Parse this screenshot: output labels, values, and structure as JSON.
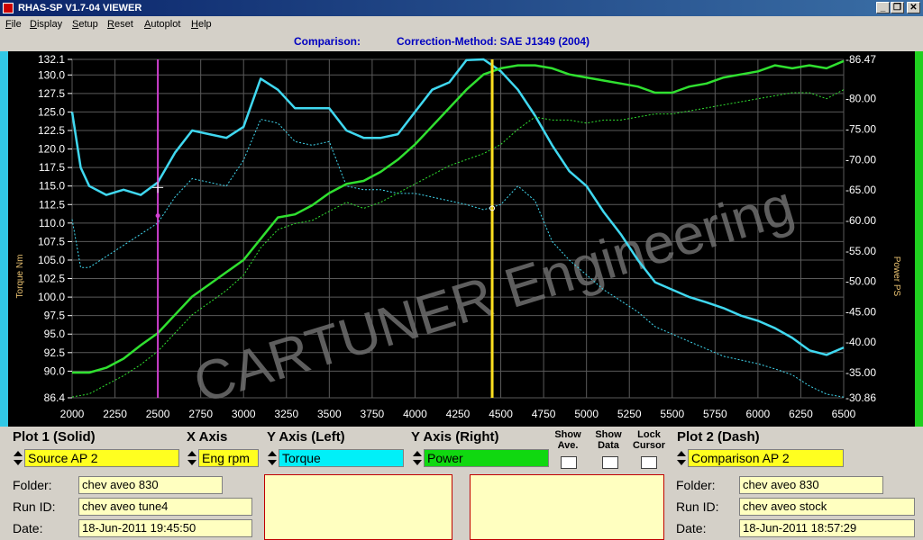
{
  "window": {
    "title": "RHAS-SP V1.7-04  VIEWER",
    "btn_min": "_",
    "btn_max": "❐",
    "btn_close": "✕"
  },
  "menu": [
    {
      "u": "F",
      "rest": "ile"
    },
    {
      "u": "D",
      "rest": "isplay"
    },
    {
      "u": "S",
      "rest": "etup"
    },
    {
      "u": "R",
      "rest": "eset"
    },
    {
      "u": "A",
      "rest": "utoplot"
    },
    {
      "u": "H",
      "rest": "elp"
    }
  ],
  "comparison": {
    "label": "Comparison:",
    "method": "Correction-Method: SAE J1349 (2004)"
  },
  "colors": {
    "torque": "#40d8f0",
    "power": "#30e030",
    "cursor": "#ffe020",
    "marker": "#d040d0",
    "grid": "#5a5a5a"
  },
  "chart_data": {
    "type": "line",
    "watermark": "CARTUNER Engineering",
    "xlabel": "",
    "ylabel_left": "Torque Nm",
    "ylabel_right": "Power PS",
    "x_ticks": [
      "2000",
      "2250",
      "2500",
      "2750",
      "3000",
      "3250",
      "3500",
      "3750",
      "4000",
      "4250",
      "4500",
      "4750",
      "5000",
      "5250",
      "5500",
      "5750",
      "6000",
      "6250",
      "6500"
    ],
    "xlim": [
      2000,
      6500
    ],
    "ylim_left": [
      86.4,
      132.1
    ],
    "ylim_right": [
      30.86,
      86.47
    ],
    "y_left_ticks": [
      "86.4",
      "90.0",
      "92.5",
      "95.0",
      "97.5",
      "100.0",
      "102.5",
      "105.0",
      "107.5",
      "110.0",
      "112.5",
      "115.0",
      "117.5",
      "120.0",
      "122.5",
      "125.0",
      "127.5",
      "130.0",
      "132.1"
    ],
    "y_right_ticks": [
      "30.86",
      "35.00",
      "40.00",
      "45.00",
      "50.00",
      "55.00",
      "60.00",
      "65.00",
      "70.00",
      "75.00",
      "80.00",
      "86.47"
    ],
    "grid": true,
    "marker_rpm": 2500,
    "cursor_rpm": 4450,
    "series": [
      {
        "axis": "left",
        "style": "solid",
        "color": "#40d8f0",
        "x": [
          2000,
          2050,
          2100,
          2200,
          2300,
          2400,
          2500,
          2600,
          2700,
          2800,
          2900,
          3000,
          3100,
          3200,
          3300,
          3400,
          3500,
          3600,
          3700,
          3800,
          3900,
          4000,
          4100,
          4200,
          4300,
          4400,
          4500,
          4600,
          4700,
          4800,
          4900,
          5000,
          5100,
          5200,
          5300,
          5400,
          5500,
          5600,
          5700,
          5800,
          5900,
          6000,
          6100,
          6200,
          6300,
          6400,
          6500
        ],
        "y": [
          125.0,
          117.5,
          115.0,
          113.8,
          114.5,
          113.8,
          115.5,
          119.5,
          122.5,
          122.0,
          121.5,
          123.0,
          129.5,
          128.0,
          125.5,
          125.5,
          125.5,
          122.5,
          121.5,
          121.5,
          122.0,
          125.0,
          128.0,
          129.0,
          132.0,
          132.1,
          130.5,
          128.0,
          124.5,
          120.5,
          117.0,
          115.0,
          111.5,
          108.5,
          105.0,
          102.0,
          101.0,
          100.0,
          99.3,
          98.5,
          97.5,
          96.8,
          95.8,
          94.5,
          92.8,
          92.2,
          93.2
        ]
      },
      {
        "axis": "left",
        "style": "dash",
        "color": "#40d8f0",
        "x": [
          2000,
          2050,
          2100,
          2200,
          2300,
          2400,
          2500,
          2600,
          2700,
          2800,
          2900,
          3000,
          3100,
          3200,
          3300,
          3400,
          3500,
          3600,
          3700,
          3800,
          3900,
          4000,
          4100,
          4200,
          4300,
          4400,
          4500,
          4600,
          4700,
          4800,
          4900,
          5000,
          5100,
          5200,
          5300,
          5400,
          5500,
          5600,
          5700,
          5800,
          5900,
          6000,
          6100,
          6200,
          6300,
          6400,
          6500
        ],
        "y": [
          110.5,
          104.0,
          104.0,
          105.5,
          107.0,
          108.5,
          110.0,
          113.5,
          116.0,
          115.5,
          115.0,
          118.5,
          124.0,
          123.5,
          121.0,
          120.5,
          121.0,
          115.0,
          114.5,
          114.5,
          114.0,
          114.0,
          113.5,
          113.0,
          112.5,
          111.8,
          112.5,
          115.0,
          113.0,
          107.5,
          105.0,
          103.0,
          101.0,
          99.5,
          98.0,
          96.0,
          95.0,
          94.0,
          93.0,
          92.0,
          91.5,
          91.0,
          90.3,
          89.5,
          88.0,
          86.9,
          86.5
        ]
      },
      {
        "axis": "right",
        "style": "solid",
        "color": "#30e030",
        "x": [
          2000,
          2100,
          2200,
          2300,
          2400,
          2500,
          2600,
          2700,
          2800,
          2900,
          3000,
          3100,
          3200,
          3300,
          3400,
          3500,
          3600,
          3700,
          3800,
          3900,
          4000,
          4100,
          4200,
          4300,
          4400,
          4500,
          4600,
          4700,
          4800,
          4900,
          5000,
          5100,
          5200,
          5300,
          5400,
          5500,
          5600,
          5700,
          5800,
          5900,
          6000,
          6100,
          6200,
          6300,
          6400,
          6500
        ],
        "y": [
          35.0,
          35.0,
          35.8,
          37.3,
          39.5,
          41.5,
          44.5,
          47.5,
          49.5,
          51.5,
          53.5,
          57.0,
          60.5,
          61.0,
          62.5,
          64.5,
          66.0,
          66.5,
          68.0,
          70.0,
          72.5,
          75.5,
          78.5,
          81.5,
          84.0,
          85.0,
          85.5,
          85.5,
          85.0,
          84.0,
          83.5,
          83.0,
          82.5,
          82.0,
          81.0,
          81.0,
          82.0,
          82.5,
          83.5,
          84.0,
          84.5,
          85.5,
          85.0,
          85.5,
          85.0,
          86.2
        ]
      },
      {
        "axis": "right",
        "style": "dash",
        "color": "#30e030",
        "x": [
          2000,
          2100,
          2200,
          2300,
          2400,
          2500,
          2600,
          2700,
          2800,
          2900,
          3000,
          3100,
          3200,
          3300,
          3400,
          3500,
          3600,
          3700,
          3800,
          3900,
          4000,
          4100,
          4200,
          4300,
          4400,
          4500,
          4600,
          4700,
          4800,
          4900,
          5000,
          5100,
          5200,
          5300,
          5400,
          5500,
          5600,
          5700,
          5800,
          5900,
          6000,
          6100,
          6200,
          6300,
          6400,
          6500
        ],
        "y": [
          31.0,
          31.5,
          33.0,
          34.5,
          36.3,
          38.5,
          41.5,
          44.5,
          46.5,
          48.5,
          51.0,
          55.5,
          58.5,
          59.5,
          60.0,
          61.5,
          63.0,
          62.0,
          63.0,
          64.5,
          66.0,
          67.5,
          69.0,
          70.0,
          71.0,
          72.5,
          75.0,
          77.0,
          76.5,
          76.5,
          76.0,
          76.5,
          76.5,
          77.0,
          77.5,
          77.5,
          78.0,
          78.5,
          79.0,
          79.5,
          80.0,
          80.5,
          81.0,
          81.0,
          80.0,
          81.5
        ]
      }
    ]
  },
  "bottom": {
    "plot1_header": "Plot 1 (Solid)",
    "xaxis_header": "X Axis",
    "yleft_header": "Y Axis (Left)",
    "yright_header": "Y Axis (Right)",
    "show_ave": "Show\nAve.",
    "show_data": "Show\nData",
    "lock_cursor": "Lock\nCursor",
    "plot2_header": "Plot 2 (Dash)",
    "plot1_source": "Source AP 2",
    "xaxis_value": "Eng rpm",
    "yleft_value": "Torque",
    "yright_value": "Power",
    "plot2_source": "Comparison AP 2",
    "folder_label": "Folder:",
    "runid_label": "Run ID:",
    "date_label": "Date:",
    "plot1_folder": "chev aveo 830",
    "plot1_runid": "chev aveo tune4",
    "plot1_date": "18-Jun-2011  19:45:50",
    "plot2_folder": "chev aveo 830",
    "plot2_runid": "chev aveo stock",
    "plot2_date": "18-Jun-2011  18:57:29"
  }
}
